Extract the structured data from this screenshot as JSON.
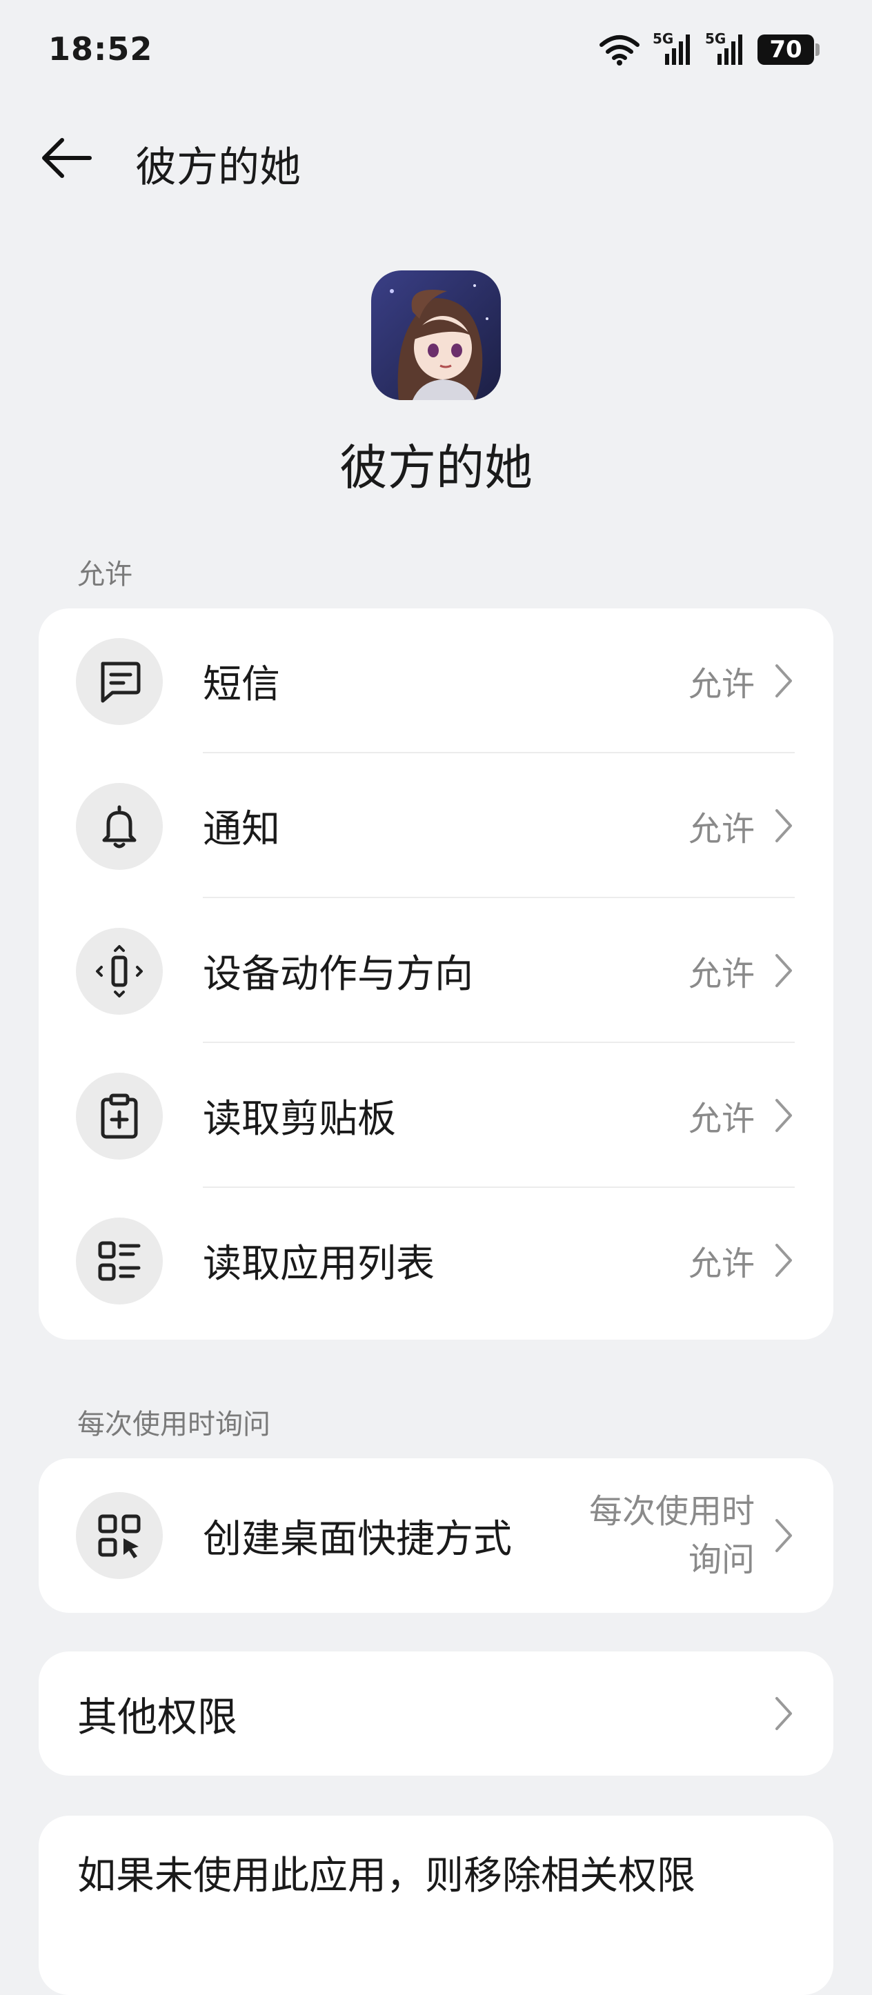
{
  "status_bar": {
    "time": "18:52",
    "network_1": "5G",
    "network_2": "5G",
    "battery": "70"
  },
  "header": {
    "title": "彼方的她"
  },
  "app": {
    "name": "彼方的她"
  },
  "sections": {
    "allowed_label": "允许",
    "ask_label": "每次使用时询问"
  },
  "allowed_permissions": [
    {
      "label": "短信",
      "value": "允许",
      "icon": "message-icon"
    },
    {
      "label": "通知",
      "value": "允许",
      "icon": "bell-icon"
    },
    {
      "label": "设备动作与方向",
      "value": "允许",
      "icon": "device-motion-icon"
    },
    {
      "label": "读取剪贴板",
      "value": "允许",
      "icon": "clipboard-icon"
    },
    {
      "label": "读取应用列表",
      "value": "允许",
      "icon": "app-list-icon"
    }
  ],
  "ask_permissions": [
    {
      "label": "创建桌面快捷方式",
      "value_line1": "每次使用时",
      "value_line2": "询问",
      "icon": "shortcut-icon"
    }
  ],
  "other": {
    "label": "其他权限"
  },
  "remove_unused": {
    "label": "如果未使用此应用，则移除相关权限"
  }
}
